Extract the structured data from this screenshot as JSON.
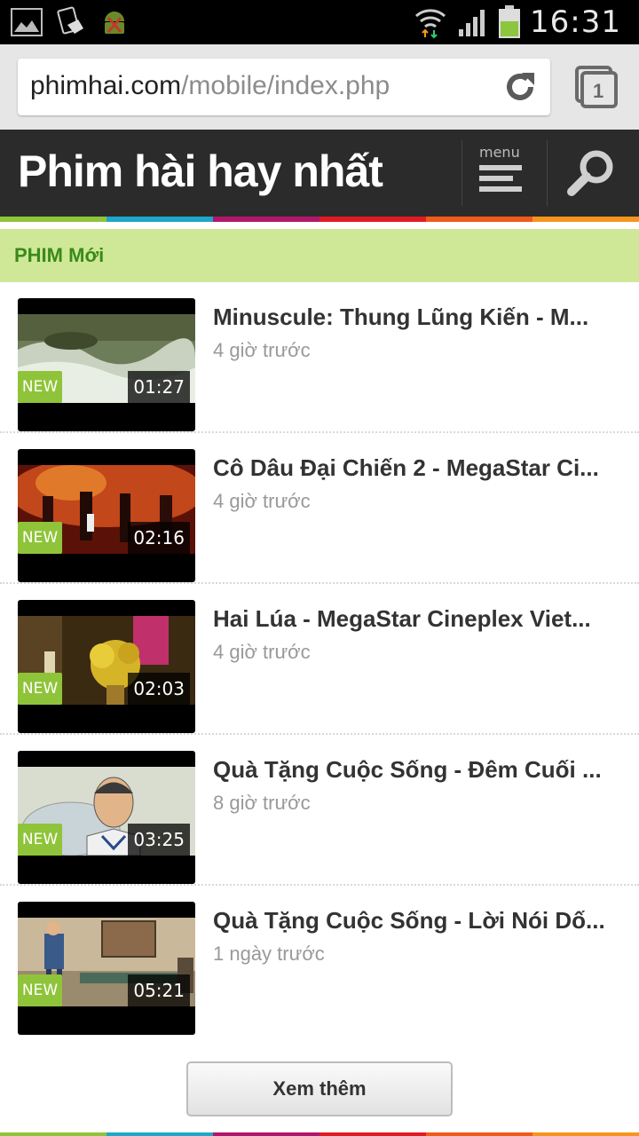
{
  "status_bar": {
    "time": "16:31",
    "icons": [
      "gallery-icon",
      "screenshot-icon",
      "android-debug-icon",
      "wifi-icon",
      "signal-icon",
      "battery-icon"
    ]
  },
  "browser": {
    "url_domain": "phimhai.com",
    "url_path": "/mobile/index.php",
    "tab_count": "1"
  },
  "site": {
    "title": "Phim hài hay nhất",
    "menu_label": "menu",
    "stripe_colors": [
      "#8fc43a",
      "#1ea7c9",
      "#b0176a",
      "#e11b22",
      "#f05a1a",
      "#f7941d"
    ]
  },
  "section": {
    "title": "PHIM Mới"
  },
  "videos": [
    {
      "title": "Minuscule: Thung Lũng Kiến - M...",
      "time": "4 giờ trước",
      "duration": "01:27",
      "badge": "NEW"
    },
    {
      "title": "Cô Dâu Đại Chiến 2 - MegaStar Ci...",
      "time": "4 giờ trước",
      "duration": "02:16",
      "badge": "NEW"
    },
    {
      "title": "Hai Lúa - MegaStar Cineplex Viet...",
      "time": "4 giờ trước",
      "duration": "02:03",
      "badge": "NEW"
    },
    {
      "title": "Quà Tặng Cuộc Sống - Đêm Cuối ...",
      "time": "8 giờ trước",
      "duration": "03:25",
      "badge": "NEW"
    },
    {
      "title": "Quà Tặng Cuộc Sống - Lời Nói Dố...",
      "time": "1 ngày trước",
      "duration": "05:21",
      "badge": "NEW"
    }
  ],
  "more_button": "Xem thêm"
}
